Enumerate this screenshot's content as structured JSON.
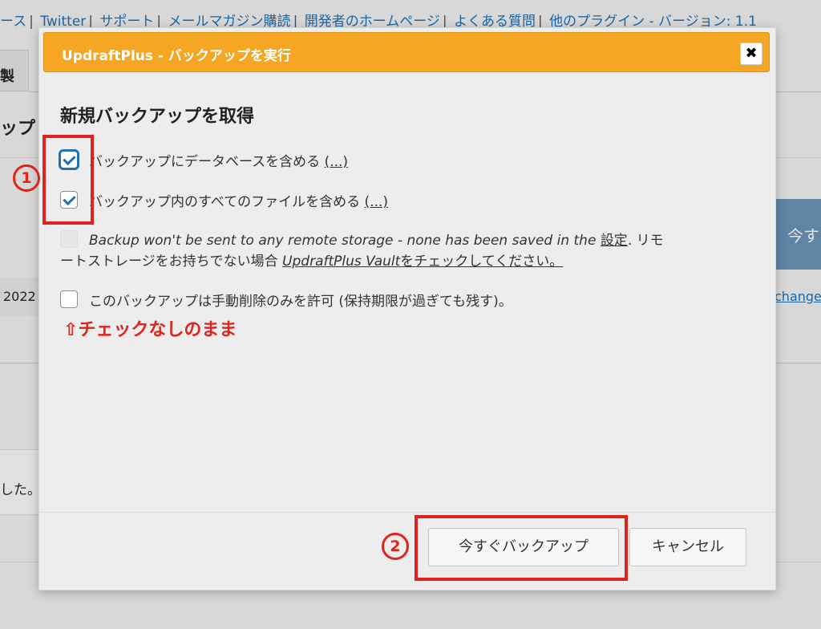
{
  "background": {
    "links": [
      "ース",
      "Twitter",
      "サポート",
      "メールマガジン購読",
      "開発者のホームページ",
      "よくある質問",
      "他のプラグイン - バージョン: 1.1"
    ],
    "tab_label": "製",
    "heading": "ップ",
    "year": "2022",
    "button_label": "今す",
    "change_link": "change",
    "footer_text": "した。"
  },
  "dialog": {
    "title": "UpdraftPlus - バックアップを実行",
    "close_label": "✖",
    "heading": "新規バックアップを取得",
    "options": [
      {
        "label": "バックアップにデータベースを含める",
        "more": "(...)",
        "checked": true
      },
      {
        "label": "バックアップ内のすべてのファイルを含める",
        "more": "(...)",
        "checked": true
      }
    ],
    "remote_italic": "Backup won't be sent to any remote storage - none has been saved in the",
    "remote_link": "設定",
    "remote_tail": ". リモ",
    "remote_line2_a": "ートストレージをお持ちでない場合 ",
    "remote_line2_vault": "UpdraftPlus Vault",
    "remote_line2_b": "をチェックしてください。",
    "manual_delete_label": "このバックアップは手動削除のみを許可 (保持期限が過ぎても残す)。",
    "annotation_note": "⇧チェックなしのまま",
    "backup_now_label": "今すぐバックアップ",
    "cancel_label": "キャンセル"
  },
  "annotations": {
    "marker_1": "1",
    "marker_2": "2"
  }
}
